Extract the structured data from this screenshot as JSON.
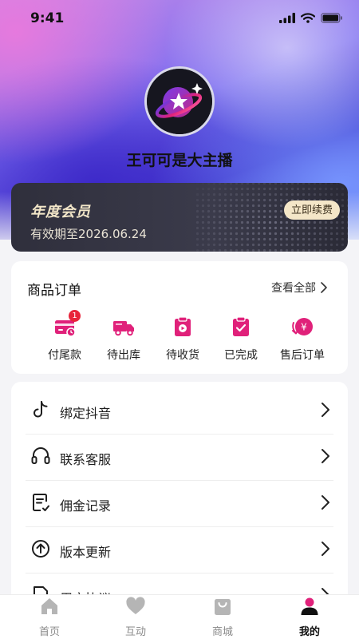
{
  "status_bar": {
    "time": "9:41"
  },
  "profile": {
    "username": "王可可是大主播"
  },
  "vip": {
    "title": "年度会员",
    "expire": "有效期至2026.06.24",
    "renew_label": "立即续费"
  },
  "orders": {
    "title": "商品订单",
    "view_all": "查看全部",
    "items": [
      {
        "label": "付尾款",
        "icon": "payment-card-icon",
        "badge": "1"
      },
      {
        "label": "待出库",
        "icon": "delivery-truck-icon"
      },
      {
        "label": "待收货",
        "icon": "package-receive-icon"
      },
      {
        "label": "已完成",
        "icon": "completed-clipboard-icon"
      },
      {
        "label": "售后订单",
        "icon": "after-sales-icon"
      }
    ]
  },
  "menu": {
    "items": [
      {
        "label": "绑定抖音",
        "icon": "tiktok-icon"
      },
      {
        "label": "联系客服",
        "icon": "headset-icon"
      },
      {
        "label": "佣金记录",
        "icon": "commission-record-icon"
      },
      {
        "label": "版本更新",
        "icon": "upload-arrow-icon"
      },
      {
        "label": "用户协议",
        "icon": "document-icon"
      }
    ]
  },
  "tabbar": {
    "tabs": [
      {
        "label": "首页",
        "icon": "home-icon",
        "active": false
      },
      {
        "label": "互动",
        "icon": "heart-icon",
        "active": false
      },
      {
        "label": "商城",
        "icon": "shopping-bag-icon",
        "active": false
      },
      {
        "label": "我的",
        "icon": "person-icon",
        "active": true
      }
    ]
  },
  "colors": {
    "accent": "#e0217a",
    "active_tab": "#111111",
    "inactive_tab": "#8a8a8a",
    "vip_gold": "#f2e6c8"
  }
}
